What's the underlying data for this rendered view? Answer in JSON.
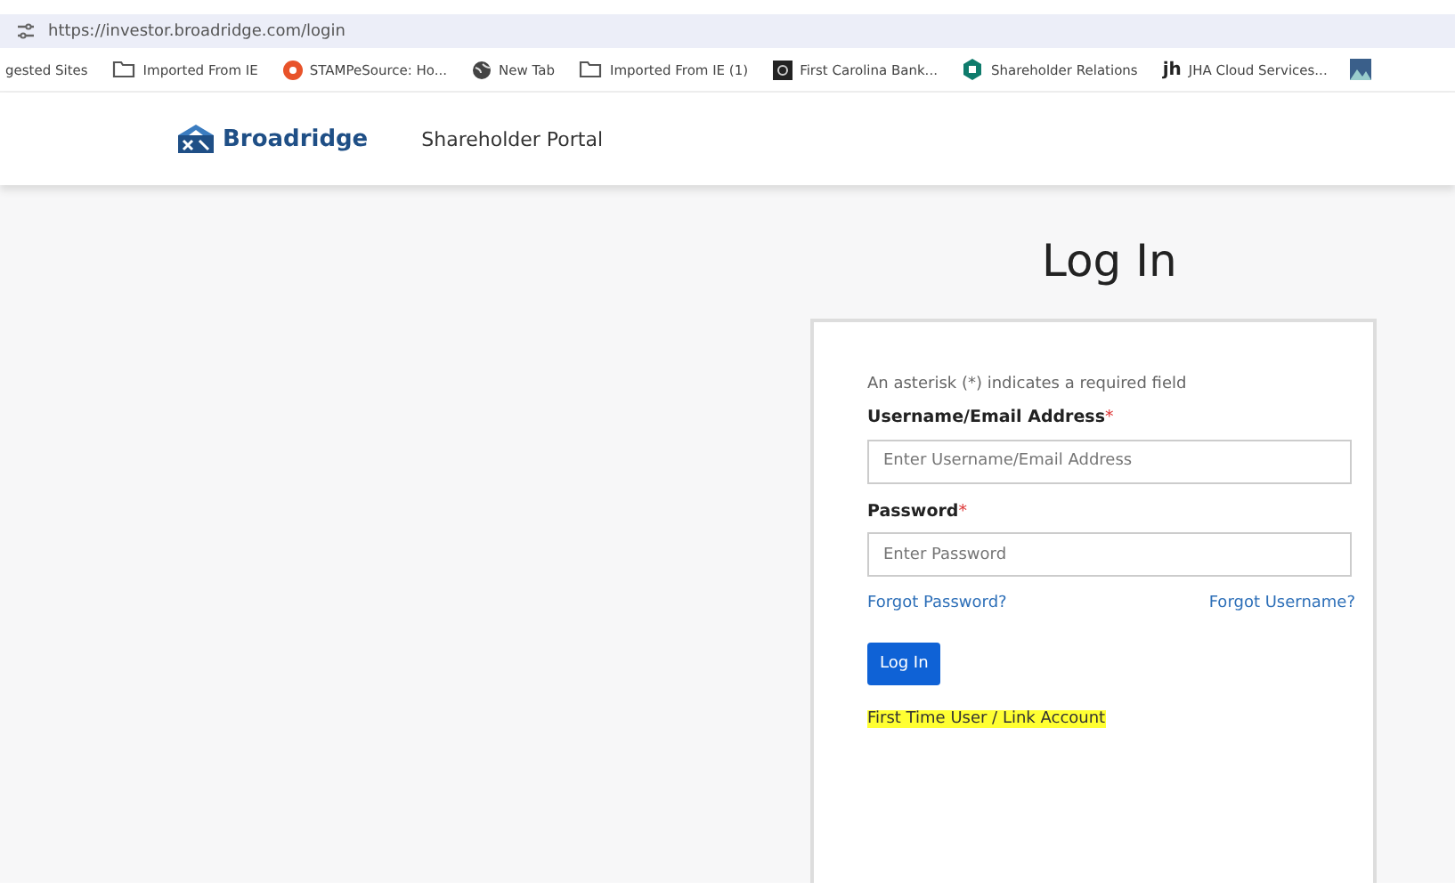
{
  "address_bar": {
    "url": "https://investor.broadridge.com/login"
  },
  "bookmarks": [
    {
      "label": "gested Sites",
      "kind": "none"
    },
    {
      "label": "Imported From IE",
      "kind": "folder"
    },
    {
      "label": "STAMPeSource: Ho...",
      "kind": "orange"
    },
    {
      "label": "New Tab",
      "kind": "globe"
    },
    {
      "label": "Imported From IE (1)",
      "kind": "folder"
    },
    {
      "label": "First Carolina Bank...",
      "kind": "dark"
    },
    {
      "label": "Shareholder Relations",
      "kind": "teal"
    },
    {
      "label": "JHA Cloud Services...",
      "kind": "text",
      "icon_text": "jh"
    },
    {
      "kind": "image"
    }
  ],
  "header": {
    "brand": "Broadridge",
    "portal": "Shareholder Portal"
  },
  "login": {
    "title": "Log In",
    "note": "An asterisk (*) indicates a required field",
    "fields": [
      {
        "label": "Username/Email Address",
        "required_mark": "*",
        "placeholder": "Enter Username/Email Address"
      },
      {
        "label": "Password",
        "required_mark": "*",
        "placeholder": "Enter Password"
      }
    ],
    "links": [
      "Forgot Password?",
      "Forgot Username?"
    ],
    "button": "Log In",
    "first_time_link": {
      "label": "First Time User / Link Account",
      "highlighted": true
    }
  }
}
